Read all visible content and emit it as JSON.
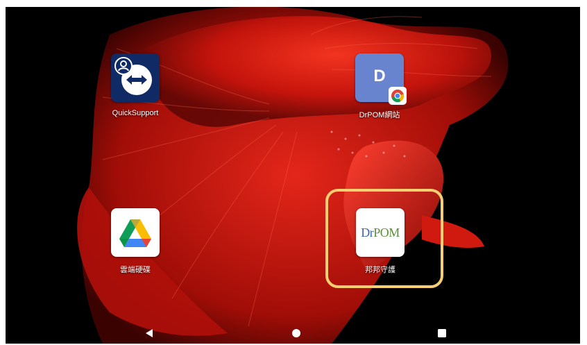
{
  "apps": [
    {
      "id": "quicksupport",
      "label": "QuickSupport",
      "icon": "teamviewer-quicksupport-icon"
    },
    {
      "id": "drpom_web",
      "label": "DrPOM網站",
      "icon": "drpom-web-shortcut-icon",
      "tile_letter": "D",
      "badge": "chrome-icon"
    },
    {
      "id": "drive",
      "label": "雲端硬碟",
      "icon": "google-drive-icon"
    },
    {
      "id": "bangbang",
      "label": "邦邦守護",
      "icon": "drpom-logo-icon",
      "logo_text_dr": "Dr",
      "logo_text_pom": "POM"
    }
  ],
  "navigation": {
    "back": "back-icon",
    "home": "home-icon",
    "recents": "recents-icon"
  },
  "colors": {
    "highlight": "#f6cf72",
    "wallpaper_primary": "#c8140c",
    "background": "#000000"
  }
}
